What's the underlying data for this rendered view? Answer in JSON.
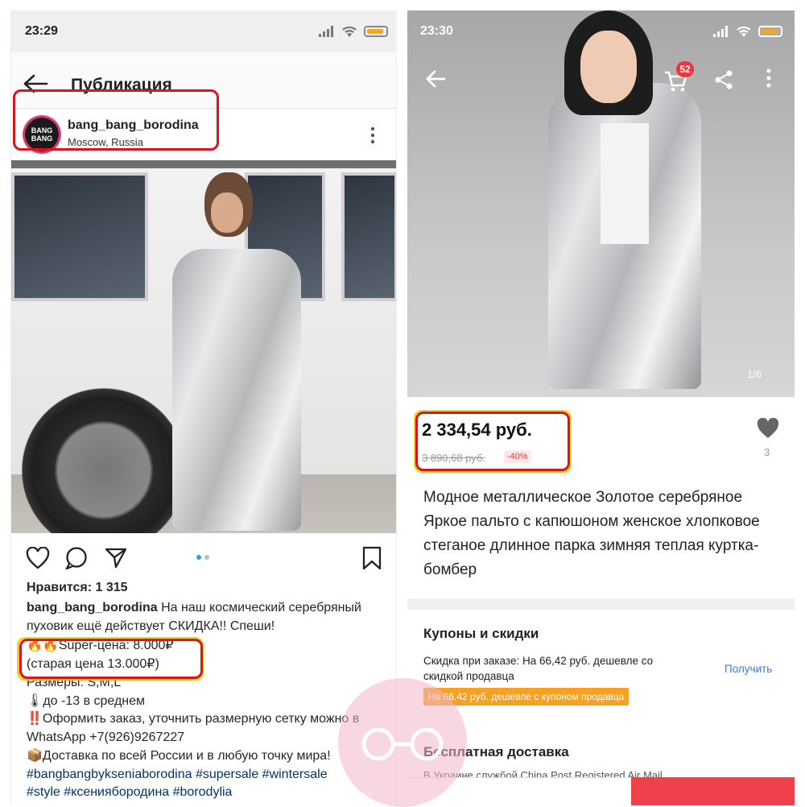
{
  "left_phone": {
    "status_time": "23:29",
    "page_title": "Публикация",
    "username": "bang_bang_borodina",
    "location": "Moscow, Russia",
    "avatar_text": "BANG BANG",
    "likes": "Нравится: 1 315",
    "caption": {
      "author": "bang_bang_borodina",
      "line1": "На наш космический серебряный пуховик ещё действует СКИДКА!! Спеши!",
      "price_line": "🔥🔥Super-цена: 8.000₽",
      "old_price_line": "(старая цена 13.000₽)",
      "sizes": "Размеры: S,M,L",
      "temp": "🌡до -13 в среднем",
      "order": "‼️Оформить заказ, уточнить размерную сетку можно в WhatsApp +7(926)9267227",
      "delivery": "📦Доставка по всей России и в любую точку мира!",
      "tags1": "#bangbangbykseniaborodina #supersale #wintersale",
      "tags2": "#style #ксениябородина #borodylia"
    }
  },
  "right_phone": {
    "status_time": "23:30",
    "cart_count": "52",
    "image_counter": "1/6",
    "price": "2 334,54 руб.",
    "old_price": "3 890,68 руб.",
    "discount": "-40%",
    "like_count": "3",
    "product_title": "Модное металлическое Золотое серебряное Яркое пальто с капюшоном женское хлопковое стеганое длинное парка зимняя теплая куртка-бомбер",
    "coupons_heading": "Купоны и скидки",
    "coupon_desc": "Скидка при заказе: На 66,42 руб. дешевле со скидкой продавца",
    "get_label": "Получить",
    "coupon_tag": "На 66,42 руб. дешевле с купоном продавца",
    "shipping_heading": "Бесплатная доставка",
    "shipping_sub": "В Украине службой China Post Registered Air Mail"
  },
  "colors": {
    "highlight": "#d7141f",
    "yellow_highlight": "#f2d21b",
    "price_red": "#f0333e",
    "coupon_orange": "#f6a122",
    "link_blue": "#3a78d6"
  }
}
